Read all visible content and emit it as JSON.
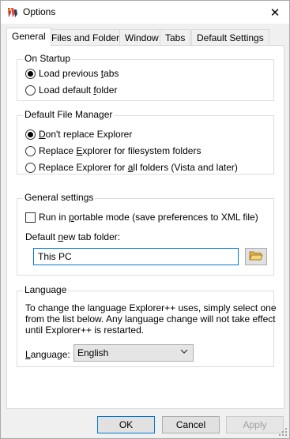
{
  "window": {
    "title": "Options",
    "close_glyph": "✕",
    "app_icon": "explorer-plus-plus-icon"
  },
  "tabs": [
    {
      "label": "General",
      "active": true
    },
    {
      "label": "Files and Folders",
      "active": false
    },
    {
      "label": "Window",
      "active": false
    },
    {
      "label": "Tabs",
      "active": false
    },
    {
      "label": "Default Settings",
      "active": false
    }
  ],
  "on_startup": {
    "title": "On Startup",
    "options": [
      {
        "pre": "Load previous ",
        "ul": "t",
        "post": "abs",
        "selected": true
      },
      {
        "pre": "Load default ",
        "ul": "f",
        "post": "older",
        "selected": false
      }
    ]
  },
  "file_manager": {
    "title": "Default File Manager",
    "options": [
      {
        "pre": "",
        "ul": "D",
        "post": "on't replace Explorer",
        "selected": true
      },
      {
        "pre": "Replace ",
        "ul": "E",
        "post": "xplorer for filesystem folders",
        "selected": false
      },
      {
        "pre": "Replace Explorer for ",
        "ul": "a",
        "post": "ll folders (Vista and later)",
        "selected": false
      }
    ]
  },
  "general_settings": {
    "title": "General settings",
    "portable": {
      "pre": "Run in ",
      "ul": "p",
      "post": "ortable mode (save preferences to XML file)",
      "checked": false
    },
    "folder_label": {
      "pre": "Default ",
      "ul": "n",
      "post": "ew tab folder:"
    },
    "folder_value": "This PC",
    "browse_icon": "folder-open-icon"
  },
  "language": {
    "title": "Language",
    "description": "To change the language Explorer++ uses, simply select one from the list below. Any language change will not take effect until Explorer++ is restarted.",
    "label": {
      "pre": "",
      "ul": "L",
      "post": "anguage:"
    },
    "selected": "English"
  },
  "footer": {
    "ok": "OK",
    "cancel": "Cancel",
    "apply": "Apply"
  },
  "colors": {
    "accent": "#0078d7",
    "panel_bg": "#ffffff",
    "window_bg": "#f0f0f0"
  }
}
